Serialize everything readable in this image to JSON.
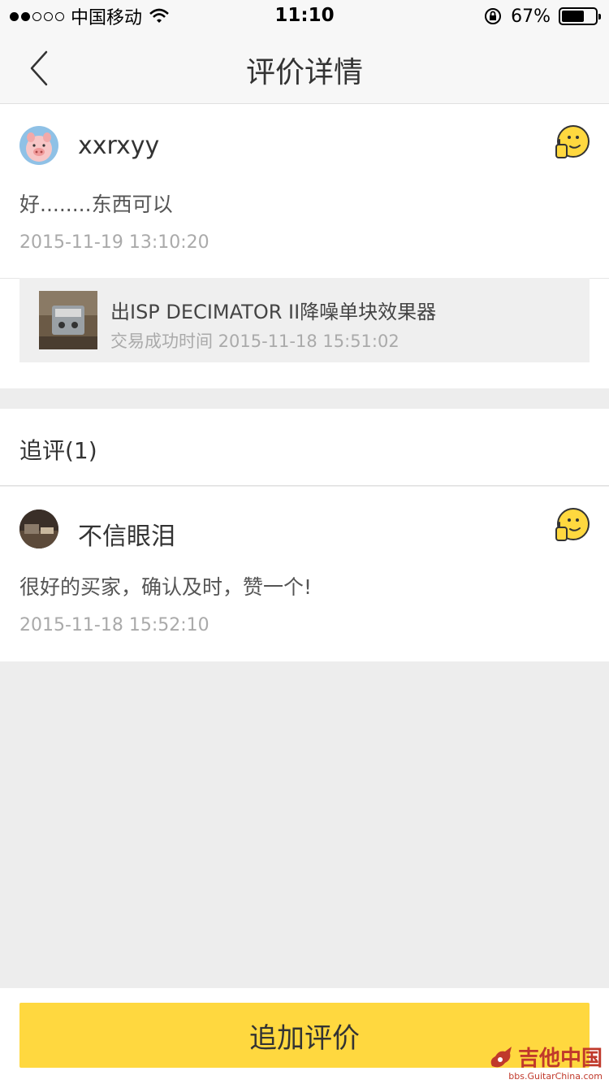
{
  "status_bar": {
    "carrier": "中国移动",
    "time": "11:10",
    "battery": "67%",
    "battery_level": 0.67
  },
  "nav": {
    "title": "评价详情"
  },
  "review": {
    "username": "xxrxyy",
    "content": "好........东西可以",
    "time": "2015-11-19 13:10:20",
    "product": {
      "title": "出ISP DECIMATOR II降噪单块效果器",
      "trade_time": "交易成功时间 2015-11-18 15:51:02"
    }
  },
  "followup": {
    "label": "追评(1)",
    "username": "不信眼泪",
    "content": "很好的买家，确认及时，赞一个!",
    "time": "2015-11-18 15:52:10"
  },
  "bottom": {
    "add_button": "追加评价"
  },
  "watermark": {
    "text": "吉他中国",
    "url": "bbs.GuitarChina.com"
  },
  "colors": {
    "accent": "#ffd83f",
    "background": "#ededed"
  }
}
